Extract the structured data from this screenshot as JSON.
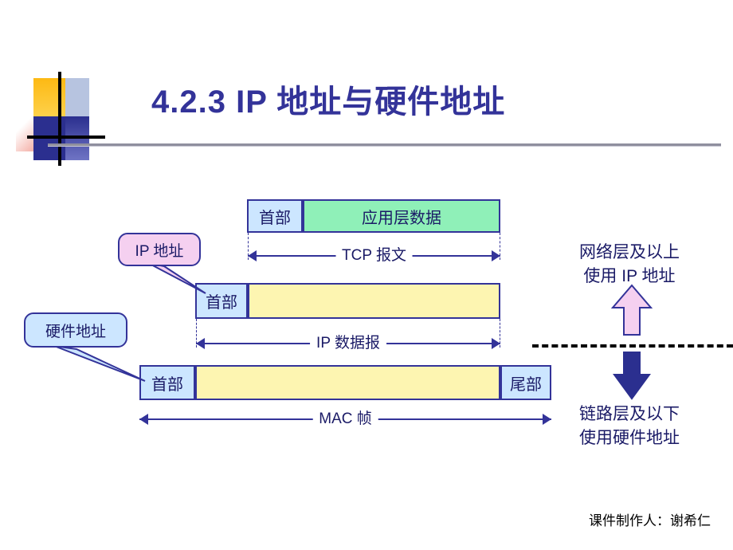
{
  "slide": {
    "title": "4.2.3  IP 地址与硬件地址",
    "footer": "课件制作人：谢希仁",
    "colors": {
      "title": "#333399",
      "outline": "#333399",
      "app_data_fill": "#8ff0b8",
      "header_fill": "#cce6ff",
      "payload_fill": "#fdf5b1",
      "ip_callout_fill": "#f5d0f0",
      "hw_callout_fill": "#cce6ff",
      "up_arrow_fill": "#f5d0f0",
      "down_arrow_fill": "#333399"
    }
  },
  "diagram": {
    "rows": [
      {
        "name": "tcp-segment",
        "cells": [
          {
            "label": "首部",
            "fill": "header_fill"
          },
          {
            "label": "应用层数据",
            "fill": "app_data_fill"
          }
        ],
        "measure": "TCP 报文"
      },
      {
        "name": "ip-datagram",
        "cells": [
          {
            "label": "首部",
            "fill": "header_fill"
          },
          {
            "label": "",
            "fill": "payload_fill"
          }
        ],
        "measure": "IP 数据报"
      },
      {
        "name": "mac-frame",
        "cells": [
          {
            "label": "首部",
            "fill": "header_fill"
          },
          {
            "label": "",
            "fill": "payload_fill"
          },
          {
            "label": "尾部",
            "fill": "header_fill"
          }
        ],
        "measure": "MAC 帧"
      }
    ],
    "callouts": [
      {
        "name": "ip-address-callout",
        "label": "IP 地址"
      },
      {
        "name": "hardware-address-callout",
        "label": "硬件地址"
      }
    ],
    "side_notes": [
      {
        "name": "upper-layer-note",
        "lines": [
          "网络层及以上",
          "使用 IP 地址"
        ]
      },
      {
        "name": "lower-layer-note",
        "lines": [
          "链路层及以下",
          "使用硬件地址"
        ]
      }
    ]
  }
}
